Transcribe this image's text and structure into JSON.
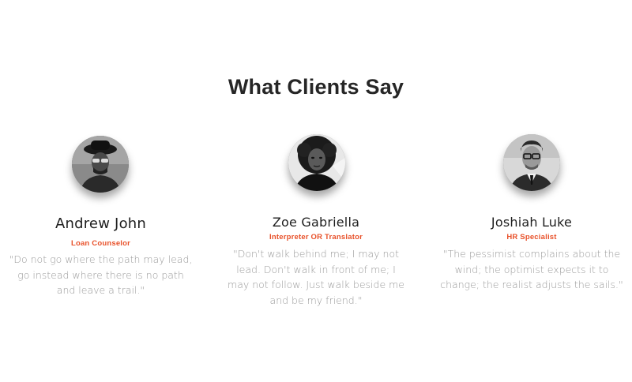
{
  "section": {
    "title": "What Clients Say"
  },
  "testimonials": [
    {
      "name": "Andrew John",
      "role": "Loan Counselor",
      "quote": "\"Do not go where the path may lead, go instead where there is no path and leave a trail.\"",
      "avatar_icon": "person-with-hat-and-sunglasses-photo"
    },
    {
      "name": "Zoe Gabriella",
      "role": "Interpreter OR Translator",
      "quote": "\"Don't walk behind me; I may not lead. Don't walk in front of me; I may not follow. Just walk beside me and be my friend.\"",
      "avatar_icon": "person-with-curly-hair-photo"
    },
    {
      "name": "Joshiah Luke",
      "role": "HR Specialist",
      "quote": "\"The pessimist complains about the wind; the optimist expects it to change; the realist adjusts the sails.\"",
      "avatar_icon": "person-with-glasses-and-suit-photo"
    }
  ],
  "colors": {
    "accent": "#e8512a",
    "title": "#262626",
    "quote": "#9a9a9a"
  }
}
